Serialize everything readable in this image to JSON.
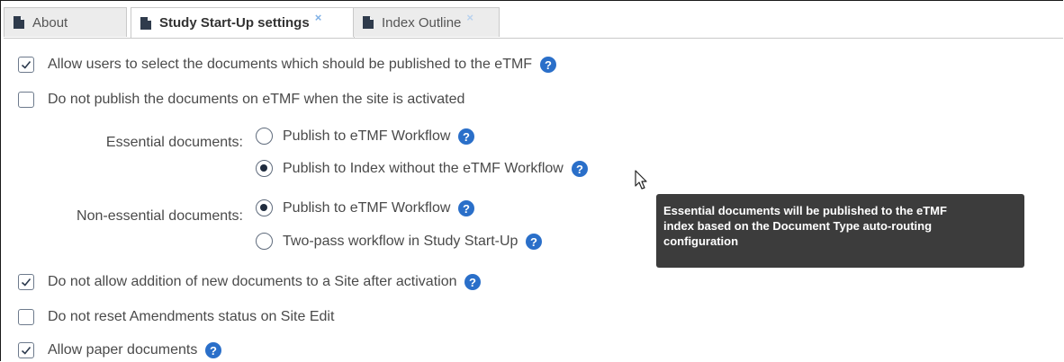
{
  "tabs": [
    {
      "label": "About",
      "active": false,
      "closable": false
    },
    {
      "label": "Study Start-Up settings",
      "active": true,
      "closable": true
    },
    {
      "label": "Index Outline",
      "active": false,
      "closable": true
    }
  ],
  "tab_close_glyph": "×",
  "settings": {
    "allow_select_publish": {
      "label": "Allow users to select the documents which should be published to the eTMF",
      "checked": true,
      "help": true
    },
    "do_not_publish_on_activation": {
      "label": "Do not publish the documents on eTMF when the site is activated",
      "checked": false,
      "help": false
    },
    "essential_documents": {
      "label": "Essential documents:",
      "options": [
        {
          "label": "Publish to eTMF Workflow",
          "selected": false,
          "help": true
        },
        {
          "label": "Publish to Index without the eTMF Workflow",
          "selected": true,
          "help": true
        }
      ]
    },
    "non_essential_documents": {
      "label": "Non-essential documents:",
      "options": [
        {
          "label": "Publish to eTMF Workflow",
          "selected": true,
          "help": true
        },
        {
          "label": "Two-pass workflow in Study Start-Up",
          "selected": false,
          "help": true
        }
      ]
    },
    "no_new_docs_after_activation": {
      "label": "Do not allow addition of new documents to a Site after activation",
      "checked": true,
      "help": true
    },
    "no_reset_amendments": {
      "label": "Do not reset Amendments status on Site Edit",
      "checked": false,
      "help": false
    },
    "allow_paper_documents": {
      "label": "Allow paper documents",
      "checked": true,
      "help": true
    }
  },
  "tooltip": {
    "lines": [
      "Essential documents will be published to the eTMF",
      "index based on the Document Type auto-routing",
      "configuration"
    ]
  },
  "icons": {
    "tab": "document-icon",
    "help": "question-circle-icon",
    "cursor": "mouse-pointer-icon"
  },
  "colors": {
    "help_blue": "#2a6fc9",
    "tooltip_bg": "#3c3c3c",
    "tab_close": "#7fb0e6"
  }
}
